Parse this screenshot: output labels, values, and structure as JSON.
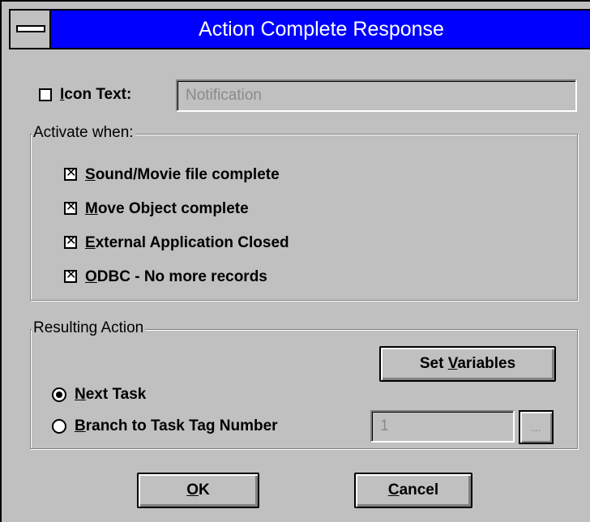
{
  "window": {
    "title": "Action Complete Response"
  },
  "icon_text": {
    "label_prefix": "I",
    "label_rest": "con Text:",
    "checked": false,
    "value": "Notification"
  },
  "activate_group": {
    "title": "Activate when:",
    "items": [
      {
        "ul": "S",
        "rest": "ound/Movie file complete",
        "checked": true
      },
      {
        "ul": "M",
        "rest": "ove Object complete",
        "checked": true
      },
      {
        "ul": "E",
        "rest": "xternal Application Closed",
        "checked": true
      },
      {
        "ul": "O",
        "rest": "DBC - No more records",
        "checked": true
      }
    ]
  },
  "resulting_group": {
    "title": "Resulting Action",
    "set_variables": {
      "pre": "Set ",
      "ul": "V",
      "rest": "ariables"
    },
    "next_task": {
      "ul": "N",
      "rest": "ext Task",
      "selected": true
    },
    "branch_task": {
      "ul": "B",
      "rest": "ranch to Task Tag Number",
      "selected": false
    },
    "tag_number_value": "1",
    "browse_label": "..."
  },
  "buttons": {
    "ok": {
      "ul": "O",
      "rest": "K"
    },
    "cancel": {
      "ul": "C",
      "rest": "ancel"
    }
  },
  "check_glyph": "✕"
}
